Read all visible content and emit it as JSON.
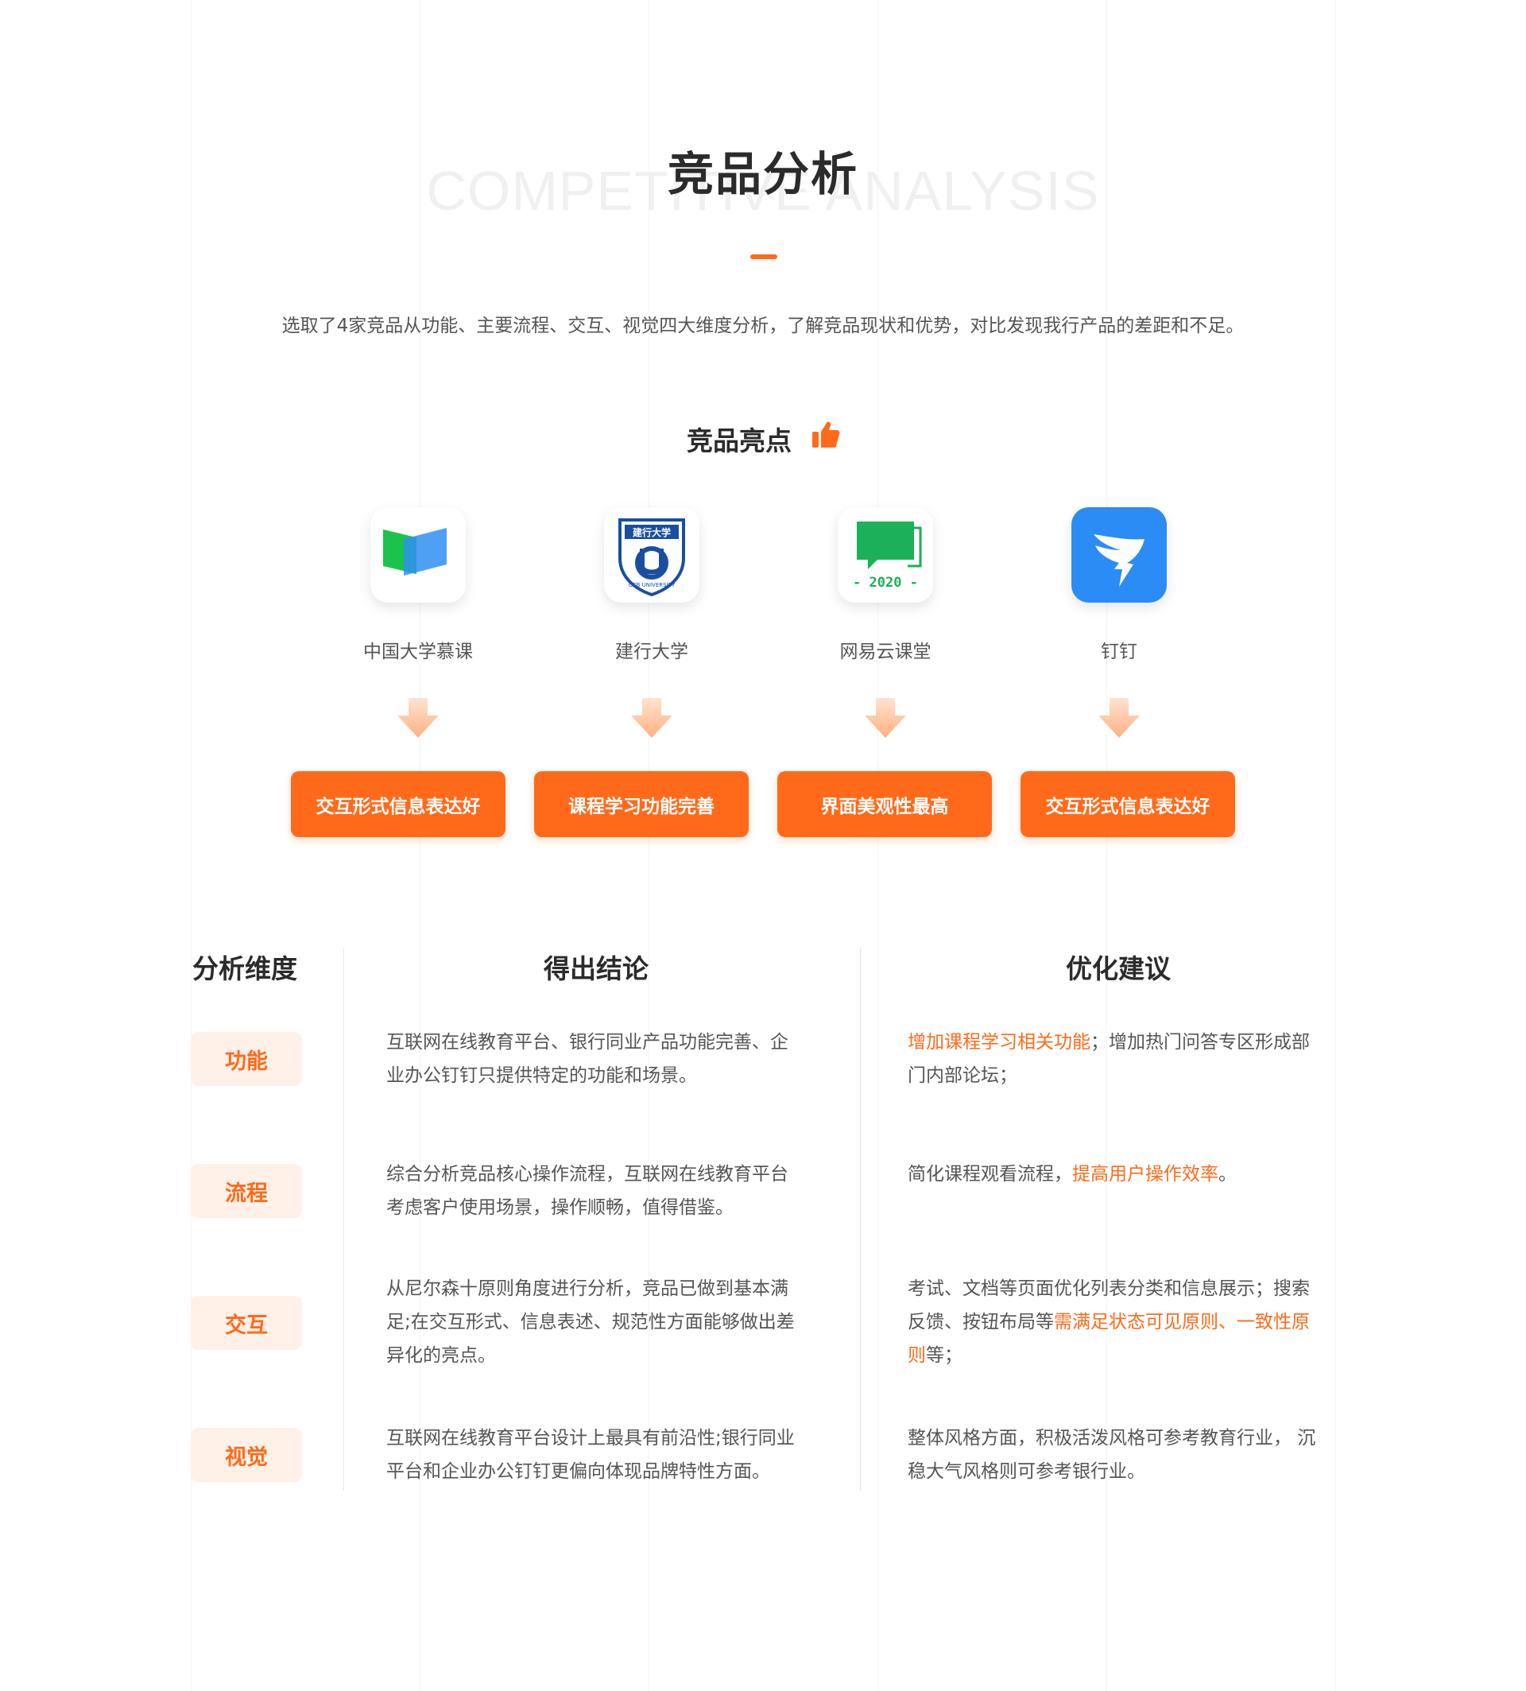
{
  "header": {
    "bg_text": "COMPETITIVE ANALYSIS",
    "title": "竞品分析",
    "intro": "选取了4家竞品从功能、主要流程、交互、视觉四大维度分析，了解竞品现状和优势，对比发现我行产品的差距和不足。"
  },
  "highlights": {
    "title": "竞品亮点",
    "products": [
      {
        "name": "中国大学慕课",
        "highlight": "交互形式信息表达好"
      },
      {
        "name": "建行大学",
        "highlight": "课程学习功能完善"
      },
      {
        "name": "网易云课堂",
        "highlight": "界面美观性最高"
      },
      {
        "name": "钉钉",
        "highlight": "交互形式信息表达好"
      }
    ],
    "ccb_logo_text": "建行大学",
    "ccb_logo_ring": "CCB UNIVERSITY",
    "netease_logo_year": "- 2020 -"
  },
  "analysis": {
    "headers": {
      "dimension": "分析维度",
      "conclusion": "得出结论",
      "suggestion": "优化建议"
    },
    "rows": [
      {
        "dimension": "功能",
        "conclusion": [
          "互联网在线教育平台、银行同业产品功能完善、企",
          "业办公钉钉只提供特定的功能和场景。"
        ],
        "suggestion": [
          [
            {
              "t": "增加课程学习相关功能",
              "h": true
            },
            {
              "t": "；增加热门问答专区形成部",
              "h": false
            }
          ],
          [
            {
              "t": "门内部论坛；",
              "h": false
            }
          ]
        ]
      },
      {
        "dimension": "流程",
        "conclusion": [
          "综合分析竞品核心操作流程，互联网在线教育平台",
          "考虑客户使用场景，操作顺畅，值得借鉴。"
        ],
        "suggestion": [
          [
            {
              "t": "简化课程观看流程，",
              "h": false
            },
            {
              "t": "提高用户操作效率",
              "h": true
            },
            {
              "t": "。",
              "h": false
            }
          ]
        ]
      },
      {
        "dimension": "交互",
        "conclusion": [
          "从尼尔森十原则角度进行分析，竞品已做到基本满",
          "足;在交互形式、信息表述、规范性方面能够做出差",
          "异化的亮点。"
        ],
        "suggestion": [
          [
            {
              "t": "考试、文档等页面优化列表分类和信息展示；搜索",
              "h": false
            }
          ],
          [
            {
              "t": "反馈、按钮布局等",
              "h": false
            },
            {
              "t": "需满足状态可见原则、一致性原",
              "h": true
            }
          ],
          [
            {
              "t": "则",
              "h": true
            },
            {
              "t": "等；",
              "h": false
            }
          ]
        ]
      },
      {
        "dimension": "视觉",
        "conclusion": [
          "互联网在线教育平台设计上最具有前沿性;银行同业",
          "平台和企业办公钉钉更偏向体现品牌特性方面。"
        ],
        "suggestion": [
          [
            {
              "t": "整体风格方面，积极活泼风格可参考教育行业， 沉",
              "h": false
            }
          ],
          [
            {
              "t": "稳大气风格则可参考银行业。",
              "h": false
            }
          ]
        ]
      }
    ]
  },
  "colors": {
    "accent": "#ff6a1a",
    "badge_bg": "#fff0e8",
    "text_dark": "#2b2b2b",
    "text_body": "#555555"
  },
  "icons": {
    "thumb": "thumbs-up-icon",
    "arrow": "arrow-down-icon",
    "mooc": "icourse-app-icon",
    "ccb": "ccb-university-app-icon",
    "netease": "netease-cloud-classroom-app-icon",
    "dingtalk": "dingtalk-app-icon"
  }
}
